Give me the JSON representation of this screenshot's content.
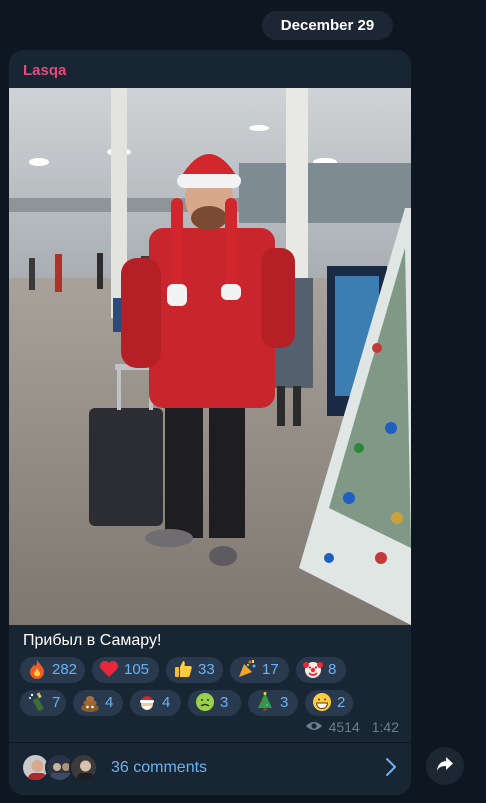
{
  "date": "December 29",
  "message": {
    "sender": "Lasqa",
    "caption": "Прибыл в Самару!",
    "views": "4514",
    "time": "1:42",
    "comments_label": "36 comments"
  },
  "reactions": [
    {
      "icon": "fire-icon",
      "count": "282"
    },
    {
      "icon": "heart-icon",
      "count": "105"
    },
    {
      "icon": "thumbs-up-icon",
      "count": "33"
    },
    {
      "icon": "party-popper-icon",
      "count": "17"
    },
    {
      "icon": "clown-face-icon",
      "count": "8"
    },
    {
      "icon": "champagne-icon",
      "count": "7"
    },
    {
      "icon": "pile-of-poo-icon",
      "count": "4"
    },
    {
      "icon": "santa-icon",
      "count": "4"
    },
    {
      "icon": "nauseated-face-icon",
      "count": "3"
    },
    {
      "icon": "christmas-tree-icon",
      "count": "3"
    },
    {
      "icon": "grinning-face-icon",
      "count": "2"
    }
  ],
  "colors": {
    "background": "#0e1621",
    "bubble": "#182533",
    "sender": "#e34b7d",
    "accent": "#6ab2f2",
    "reaction_bg": "#2a3a4e",
    "meta": "#6d7f8f"
  }
}
